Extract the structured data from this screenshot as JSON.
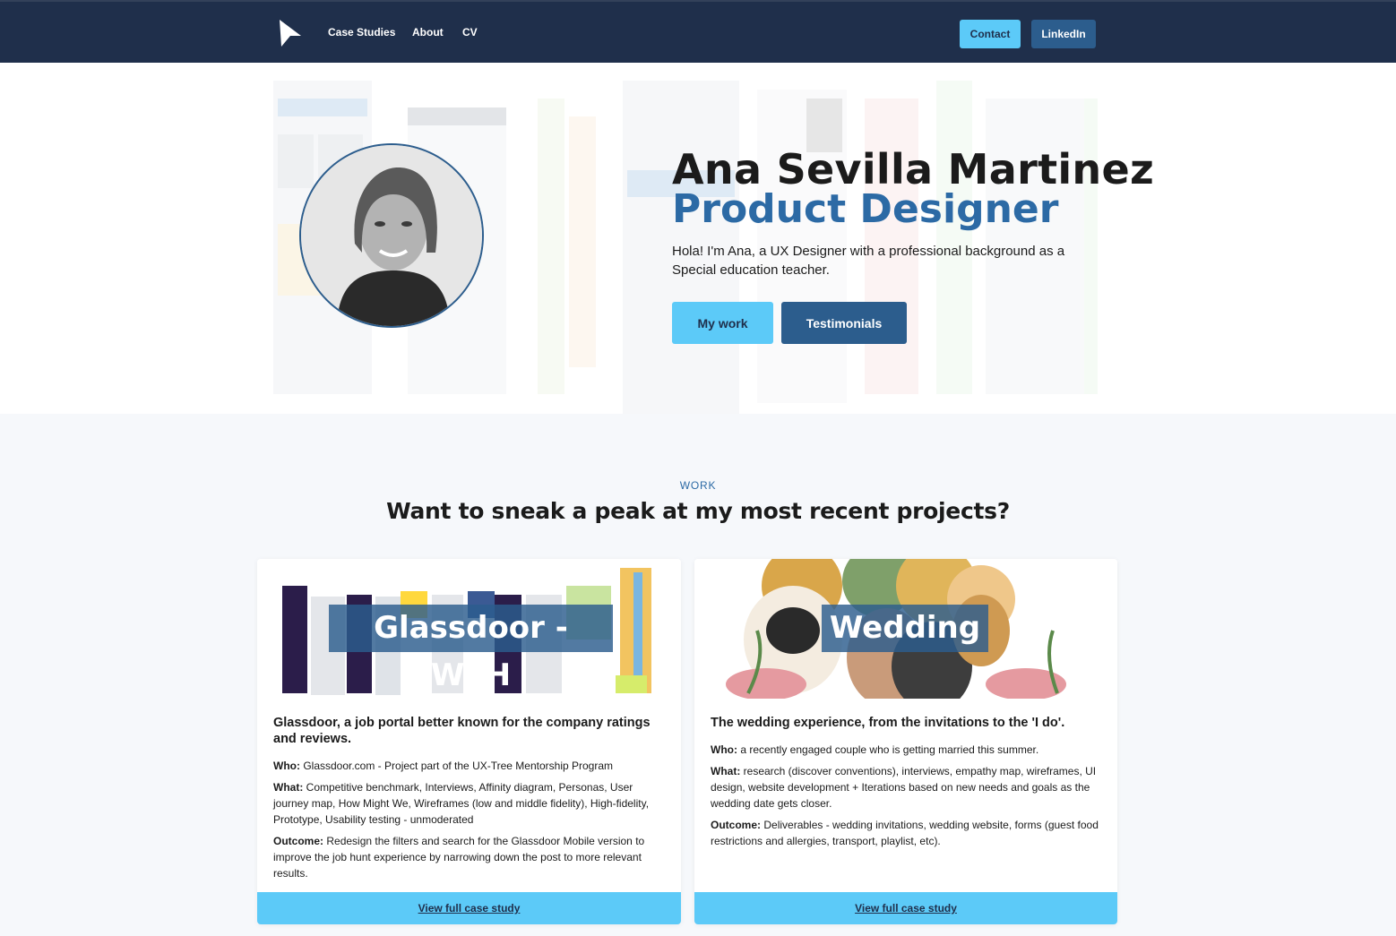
{
  "nav": {
    "logo_icon": "cursor-arrow-logo",
    "links": [
      "Case Studies",
      "About",
      "CV"
    ],
    "contact_label": "Contact",
    "linkedin_label": "LinkedIn"
  },
  "hero": {
    "name": "Ana Sevilla Martinez",
    "role": "Product Designer",
    "intro": "Hola! I'm Ana, a UX Designer with a professional background as a Special education teacher.",
    "my_work_label": "My work",
    "testimonials_label": "Testimonials"
  },
  "work": {
    "eyebrow": "WORK",
    "title": "Want to sneak a peak at my most recent projects?",
    "cards": [
      {
        "tag": "Glassdoor - WFH",
        "headline": "Glassdoor, a job portal better known for the company ratings and reviews.",
        "who_label": "Who:",
        "who": " Glassdoor.com - Project part of the UX-Tree Mentorship Program",
        "what_label": "What:",
        "what": " Competitive benchmark, Interviews, Affinity diagram, Personas, User journey map, How Might We, Wireframes (low and middle fidelity), High-fidelity, Prototype, Usability testing - unmoderated",
        "outcome_label": "Outcome:",
        "outcome": " Redesign the filters and search for the Glassdoor Mobile version to improve the job hunt experience by narrowing down the post to more relevant results.",
        "cta": "View full case study"
      },
      {
        "tag": "Wedding",
        "headline": "The wedding experience, from the invitations to the 'I do'.",
        "who_label": "Who:",
        "who": " a recently engaged couple who is getting married this summer.",
        "what_label": "What:",
        "what": " research (discover conventions), interviews, empathy map, wireframes, UI design, website development + Iterations based on new needs and goals as the wedding date gets closer.",
        "outcome_label": "Outcome:",
        "outcome": " Deliverables - wedding invitations, wedding website, forms (guest food restrictions and allergies, transport, playlist, etc).",
        "cta": "View full case study"
      }
    ]
  }
}
